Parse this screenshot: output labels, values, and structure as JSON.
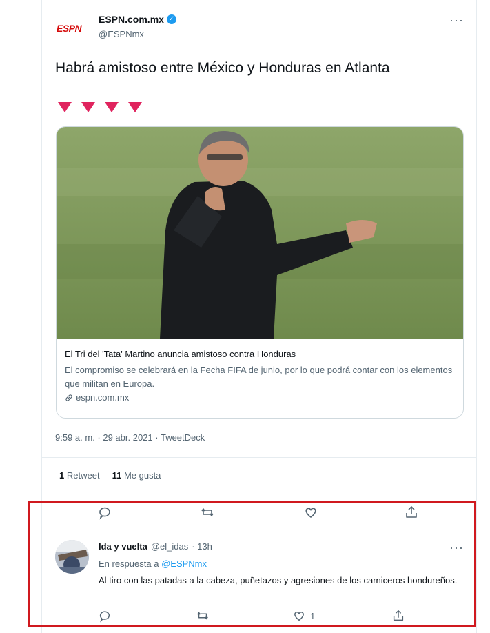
{
  "tweet": {
    "logo_text": "ESPN",
    "display_name": "ESPN.com.mx",
    "handle": "@ESPNmx",
    "text": "Habrá amistoso entre México y Honduras en Atlanta",
    "link_card": {
      "title": "El Tri del 'Tata' Martino anuncia amistoso contra Honduras",
      "description": "El compromiso se celebrará en la Fecha FIFA de junio, por lo que podrá contar con los elementos que militan en Europa.",
      "domain": "espn.com.mx"
    },
    "timestamp": "9:59 a. m. · 29 abr. 2021 · TweetDeck",
    "retweets_count": "1",
    "retweets_label": "Retweet",
    "likes_count": "11",
    "likes_label": "Me gusta"
  },
  "reply": {
    "display_name": "Ida y vuelta",
    "handle": "@el_idas",
    "time": "· 13h",
    "reply_to_prefix": "En respuesta a",
    "reply_to_handle": "@ESPNmx",
    "text": "Al tiro con las patadas a la cabeza, puñetazos y agresiones de los carniceros hondureños.",
    "like_count": "1"
  },
  "colors": {
    "accent": "#1d9bf0",
    "highlight_border": "#d0191f",
    "triangle": "#e0245e",
    "logo": "#d50a0a"
  },
  "icons": [
    "more-icon",
    "verified-icon",
    "link-icon",
    "reply-icon",
    "retweet-icon",
    "like-icon",
    "share-icon"
  ]
}
